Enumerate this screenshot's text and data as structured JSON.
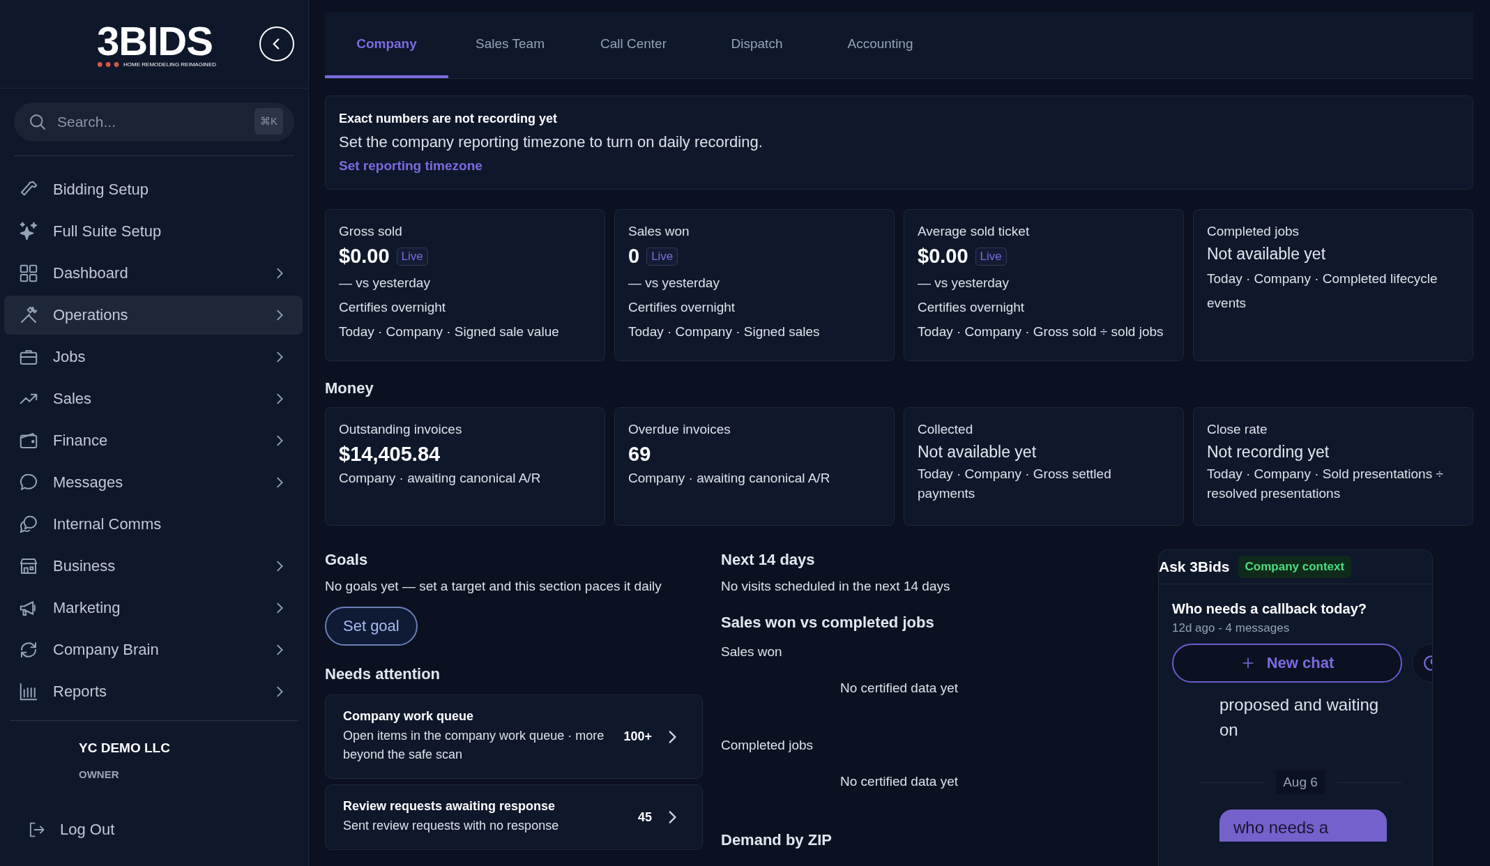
{
  "sidebar": {
    "logo": {
      "wordmark": "3BIDS",
      "tagline": "HOME REMODELING REIMAGINED"
    },
    "search": {
      "placeholder": "Search...",
      "shortcut": "⌘K"
    },
    "items": [
      {
        "label": "Bidding Setup",
        "expandable": false,
        "selected": false
      },
      {
        "label": "Full Suite Setup",
        "expandable": false,
        "selected": false
      },
      {
        "label": "Dashboard",
        "expandable": true,
        "selected": false
      },
      {
        "label": "Operations",
        "expandable": true,
        "selected": true
      },
      {
        "label": "Jobs",
        "expandable": true,
        "selected": false
      },
      {
        "label": "Sales",
        "expandable": true,
        "selected": false
      },
      {
        "label": "Finance",
        "expandable": true,
        "selected": false
      },
      {
        "label": "Messages",
        "expandable": true,
        "selected": false
      },
      {
        "label": "Internal Comms",
        "expandable": false,
        "selected": false
      },
      {
        "label": "Business",
        "expandable": true,
        "selected": false
      },
      {
        "label": "Marketing",
        "expandable": true,
        "selected": false
      },
      {
        "label": "Company Brain",
        "expandable": true,
        "selected": false
      },
      {
        "label": "Reports",
        "expandable": true,
        "selected": false
      }
    ],
    "account": {
      "company": "YC DEMO LLC",
      "role": "OWNER"
    },
    "logout": "Log Out"
  },
  "tabs": [
    {
      "label": "Company",
      "selected": true
    },
    {
      "label": "Sales Team",
      "selected": false
    },
    {
      "label": "Call Center",
      "selected": false
    },
    {
      "label": "Dispatch",
      "selected": false
    },
    {
      "label": "Accounting",
      "selected": false
    }
  ],
  "banner": {
    "title": "Exact numbers are not recording yet",
    "text": "Set the company reporting timezone to turn on daily recording.",
    "link": "Set reporting timezone"
  },
  "stat_cards": [
    {
      "kind": "value",
      "label": "Gross sold",
      "value": "$0.00",
      "live": true,
      "badge": "Live",
      "lines": [
        "— vs yesterday",
        "Certifies overnight",
        "Today · Company · Signed sale value"
      ]
    },
    {
      "kind": "value",
      "label": "Sales won",
      "value": "0",
      "live": true,
      "badge": "Live",
      "lines": [
        "— vs yesterday",
        "Certifies overnight",
        "Today · Company · Signed sales"
      ]
    },
    {
      "kind": "value",
      "label": "Average sold ticket",
      "value": "$0.00",
      "live": true,
      "badge": "Live",
      "lines": [
        "— vs yesterday",
        "Certifies overnight",
        "Today · Company · Gross sold ÷ sold jobs"
      ]
    },
    {
      "kind": "status",
      "label": "Completed jobs",
      "value": "Not available yet",
      "live": false,
      "lines": [
        "Today · Company · Completed lifecycle events"
      ]
    }
  ],
  "money": {
    "title": "Money",
    "cards": [
      {
        "kind": "value",
        "label": "Outstanding invoices",
        "value": "$14,405.84",
        "lines": [
          "Company · awaiting canonical A/R"
        ]
      },
      {
        "kind": "value",
        "label": "Overdue invoices",
        "value": "69",
        "lines": [
          "Company · awaiting canonical A/R"
        ]
      },
      {
        "kind": "status",
        "label": "Collected",
        "value": "Not available yet",
        "lines": [
          "Today · Company · Gross settled payments"
        ]
      },
      {
        "kind": "status",
        "label": "Close rate",
        "value": "Not recording yet",
        "lines": [
          "Today · Company · Sold presentations ÷ resolved presentations"
        ]
      }
    ]
  },
  "goals": {
    "title": "Goals",
    "text": "No goals yet — set a target and this section paces it daily",
    "button": "Set goal"
  },
  "needs_attention": {
    "title": "Needs attention",
    "items": [
      {
        "title": "Company work queue",
        "text": "Open items in the company work queue · more beyond the safe scan",
        "count": "100+"
      },
      {
        "title": "Review requests awaiting response",
        "text": "Sent review requests with no response",
        "count": "45"
      }
    ]
  },
  "next_days": {
    "title": "Next 14 days",
    "text": "No visits scheduled in the next 14 days"
  },
  "comparison": {
    "title": "Sales won vs completed jobs",
    "series": [
      {
        "name": "Sales won",
        "empty": "No certified data yet"
      },
      {
        "name": "Completed jobs",
        "empty": "No certified data yet"
      }
    ]
  },
  "demand": {
    "title": "Demand by ZIP"
  },
  "assistant": {
    "title": "Ask 3Bids",
    "badge": "Company context",
    "conversation": "Who needs a callback today?",
    "meta": "12d ago - 4 messages",
    "new_chat": "New chat",
    "message": "proposed and waiting on",
    "date": "Aug 6",
    "user_message": "who needs a"
  }
}
